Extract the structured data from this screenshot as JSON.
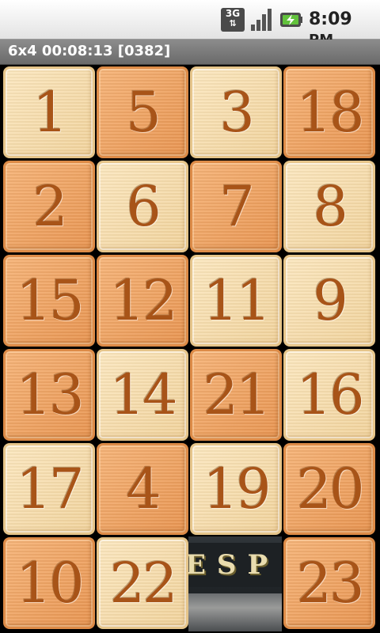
{
  "status_bar": {
    "network": "3G",
    "time": "8:09",
    "meridiem": "PM"
  },
  "title_bar": {
    "text": "6x4 00:08:13 [0382]"
  },
  "puzzle": {
    "rows": 6,
    "cols": 4,
    "tiles": [
      "1",
      "5",
      "3",
      "18",
      "2",
      "6",
      "7",
      "8",
      "15",
      "12",
      "11",
      "9",
      "13",
      "14",
      "21",
      "16",
      "17",
      "4",
      "19",
      "20",
      "10",
      "22",
      "",
      "23"
    ],
    "shades": [
      "light",
      "dark",
      "light",
      "dark",
      "dark",
      "light",
      "dark",
      "light",
      "dark",
      "dark",
      "light",
      "light",
      "dark",
      "light",
      "dark",
      "light",
      "light",
      "dark",
      "light",
      "dark",
      "dark",
      "light",
      "empty",
      "dark"
    ],
    "empty_slot_image_text": "ESP"
  },
  "colors": {
    "tile_light": "#f6dcaa",
    "tile_dark": "#f0a462",
    "numeral": "#a85418",
    "title_bar": "#7a7a7a"
  }
}
